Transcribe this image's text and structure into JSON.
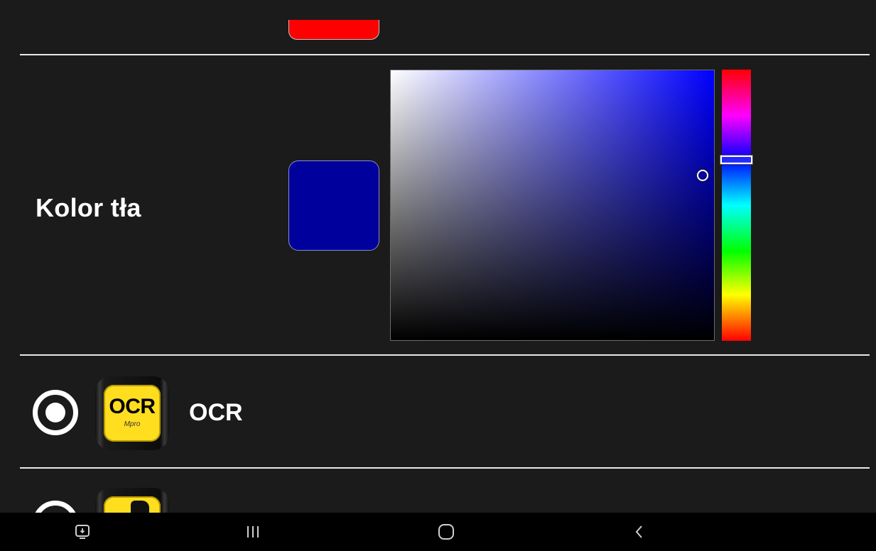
{
  "colors": {
    "background": "#1b1b1b",
    "top_swatch": "#ff0000",
    "selected_background_color": "#00009c",
    "hue_reference": "#0000ff",
    "navbar": "#000000",
    "app_icon_yellow": "#ffde1f"
  },
  "previous_setting": {
    "swatch_color": "#ff0000"
  },
  "background_color_setting": {
    "label": "Kolor tła",
    "color_picker": {
      "saturation_percent": 100,
      "brightness_percent": 61,
      "hue_degrees": 240
    }
  },
  "app_list": {
    "items": [
      {
        "name": "OCR",
        "icon": "ocr-mpro-app-icon",
        "icon_text": "OCR",
        "icon_subtext": "Mpro",
        "selected": true
      },
      {
        "name": "",
        "icon": "hand-app-icon",
        "selected": false
      }
    ]
  },
  "navigation_bar": {
    "buttons": [
      {
        "icon": "screen-share-icon"
      },
      {
        "icon": "recents-icon"
      },
      {
        "icon": "home-icon"
      },
      {
        "icon": "back-icon"
      }
    ]
  }
}
